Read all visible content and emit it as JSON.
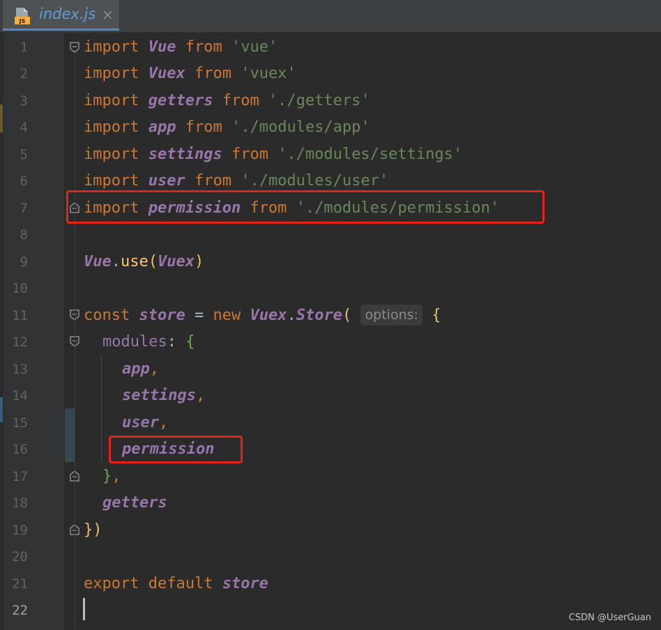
{
  "tab": {
    "title": "index.js",
    "close": "×",
    "icon_label": "JS"
  },
  "line_numbers": [
    "1",
    "2",
    "3",
    "4",
    "5",
    "6",
    "7",
    "8",
    "9",
    "10",
    "11",
    "12",
    "13",
    "14",
    "15",
    "16",
    "17",
    "18",
    "19",
    "20",
    "21",
    "22"
  ],
  "code": {
    "l1": [
      "import",
      "Vue",
      "from",
      "'vue'"
    ],
    "l2": [
      "import",
      "Vuex",
      "from",
      "'vuex'"
    ],
    "l3": [
      "import",
      "getters",
      "from",
      "'./getters'"
    ],
    "l4": [
      "import",
      "app",
      "from",
      "'./modules/app'"
    ],
    "l5": [
      "import",
      "settings",
      "from",
      "'./modules/settings'"
    ],
    "l6": [
      "import",
      "user",
      "from",
      "'./modules/user'"
    ],
    "l7": [
      "import",
      "permission",
      "from",
      "'./modules/permission'"
    ],
    "l9": [
      "Vue",
      ".",
      "use",
      "(",
      "Vuex",
      ")"
    ],
    "l11": [
      "const",
      "store",
      "=",
      "new",
      "Vuex",
      ".",
      "Store",
      "(",
      "options:",
      "{"
    ],
    "l12": [
      "modules",
      ":",
      "{"
    ],
    "l13": [
      "app",
      ","
    ],
    "l14": [
      "settings",
      ","
    ],
    "l15": [
      "user",
      ","
    ],
    "l16": [
      "permission"
    ],
    "l17": [
      "}",
      ","
    ],
    "l18": [
      "getters"
    ],
    "l19": [
      "}",
      ")"
    ],
    "l21": [
      "export",
      "default",
      "store"
    ]
  },
  "watermark": "CSDN @UserGuan"
}
